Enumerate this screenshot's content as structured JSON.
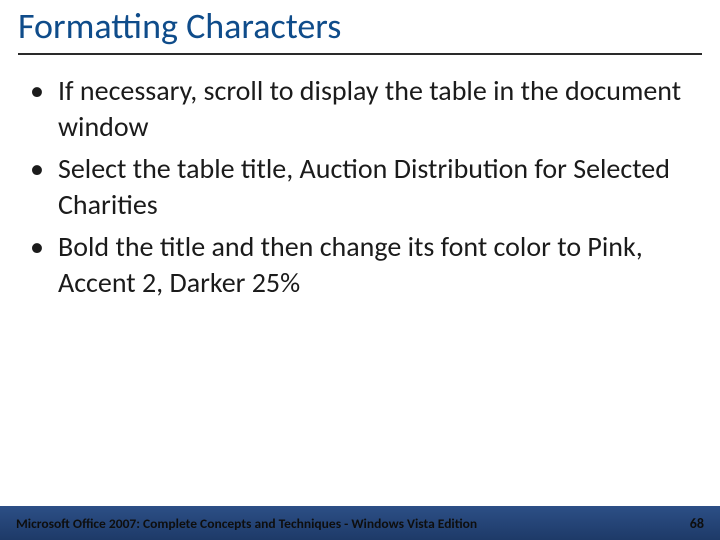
{
  "title": "Formatting Characters",
  "bullets": [
    "If necessary, scroll to display the table in the document window",
    "Select the table title, Auction Distribution for Selected Charities",
    "Bold the title and then change its font color to Pink, Accent 2, Darker 25%"
  ],
  "footer": {
    "text": "Microsoft Office 2007: Complete Concepts and Techniques - Windows Vista Edition",
    "page": "68"
  }
}
